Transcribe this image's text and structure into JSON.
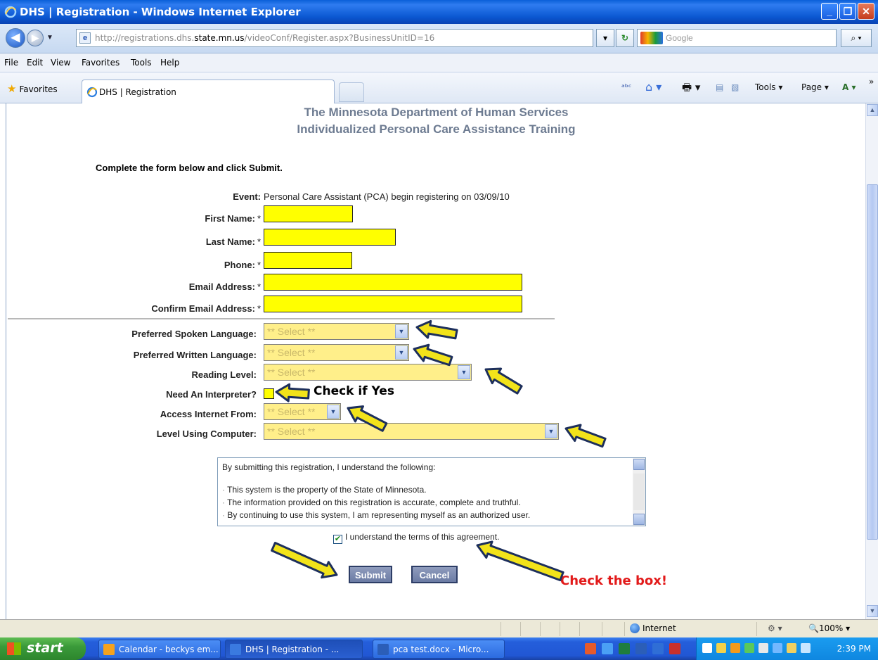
{
  "window": {
    "title": "DHS | Registration - Windows Internet Explorer",
    "minimize": "_",
    "maximize": "❐",
    "close": "✕"
  },
  "address_bar": {
    "url_prefix": "http://registrations.dhs.",
    "url_domain": "state.mn.us",
    "url_suffix": "/videoConf/Register.aspx?BusinessUnitID=16",
    "search_placeholder": "Google"
  },
  "menu": [
    "File",
    "Edit",
    "View",
    "Favorites",
    "Tools",
    "Help"
  ],
  "favorites_bar": {
    "favorites_label": "Favorites",
    "tab_label": "DHS | Registration",
    "tools_label": "Tools ▾",
    "page_label": "Page ▾"
  },
  "page": {
    "heading1": "The Minnesota Department of Human Services",
    "heading2": "Individualized Personal Care Assistance Training",
    "intro": "Complete the form below and click Submit.",
    "event_label": "Event:",
    "event_value": "Personal Care Assistant (PCA) begin registering on 03/09/10"
  },
  "form": {
    "required_mark": "*",
    "first_name_label": "First Name:",
    "last_name_label": "Last Name:",
    "phone_label": "Phone:",
    "email_label": "Email Address:",
    "confirm_email_label": "Confirm Email Address:",
    "spoken_language_label": "Preferred Spoken Language:",
    "written_language_label": "Preferred Written Language:",
    "reading_level_label": "Reading Level:",
    "interpreter_label": "Need An Interpreter?",
    "access_internet_label": "Access Internet From:",
    "computer_level_label": "Level Using Computer:",
    "select_placeholder": "** Select **"
  },
  "terms": {
    "intro": "By submitting this registration, I understand the following:",
    "items": [
      "This system is the property of the State of Minnesota.",
      "The information provided on this registration is accurate, complete and truthful.",
      "By continuing to use this system, I am representing myself as an authorized user."
    ],
    "bullet": "·",
    "agree_label": "I understand the terms of this agreement.",
    "agree_checked": true
  },
  "buttons": {
    "submit": "Submit",
    "cancel": "Cancel"
  },
  "annotations": {
    "check_if_yes": "Check if Yes",
    "check_the_box": "Check the box!",
    "arrow_color": "#1d2f5c",
    "arrow_fill": "#f2e31a"
  },
  "status_bar": {
    "zone": "Internet",
    "zoom": "100%"
  },
  "taskbar": {
    "start": "start",
    "tasks": [
      "Calendar - beckys em...",
      "DHS | Registration - ...",
      "pca test.docx - Micro..."
    ],
    "clock": "2:39 PM"
  },
  "colors": {
    "required_field": "#ffff00",
    "select_field": "#ffef8a",
    "heading": "#6d7b91",
    "annotation_red": "#e21a1a"
  }
}
